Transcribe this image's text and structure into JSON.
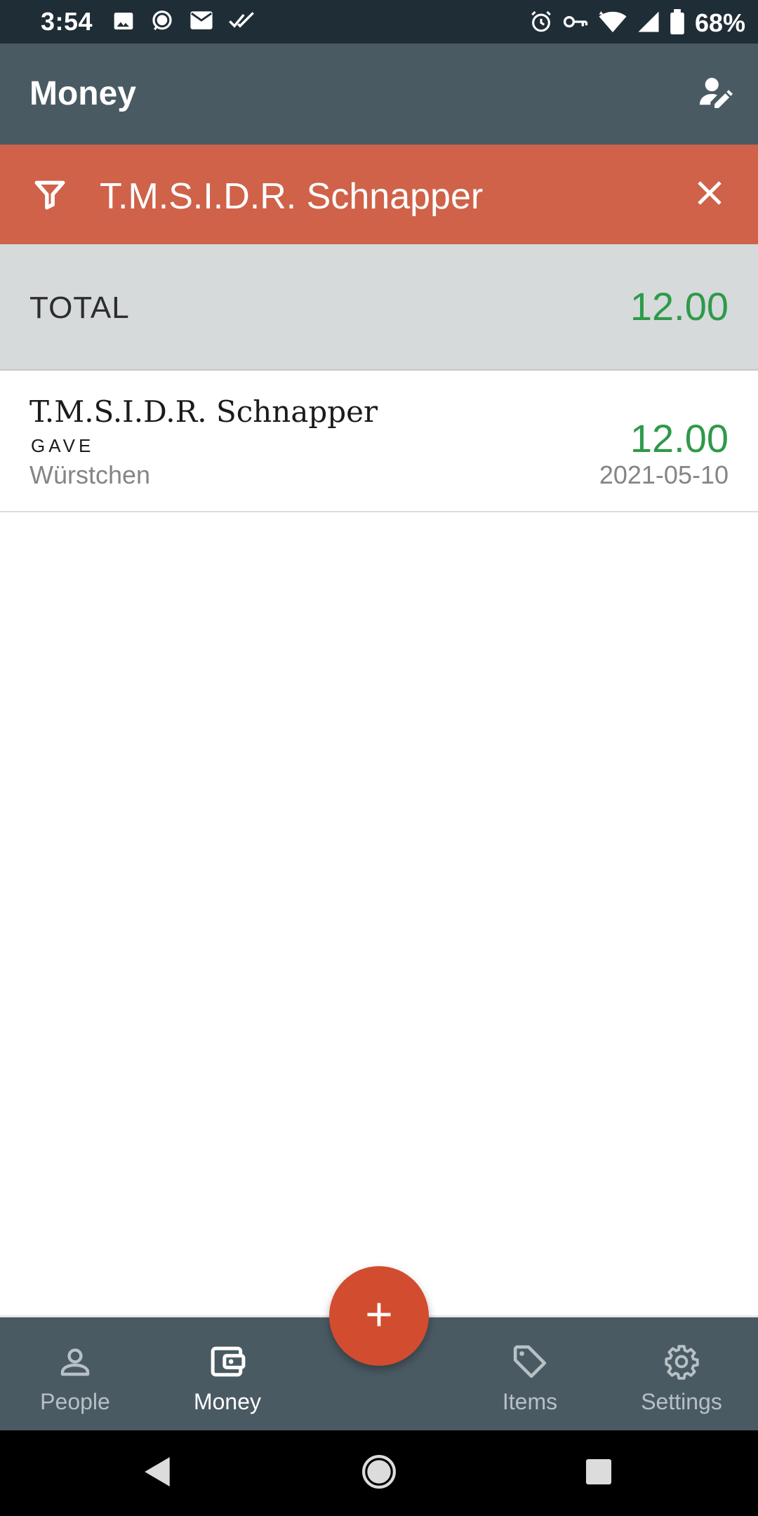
{
  "status_bar": {
    "time": "3:54",
    "battery": "68%",
    "left_icons": [
      "image-icon",
      "chat-bubble-icon",
      "mail-icon",
      "double-check-icon"
    ],
    "right_icons": [
      "alarm-icon",
      "key-icon",
      "wifi-icon",
      "signal-icon",
      "battery-icon"
    ]
  },
  "app_bar": {
    "title": "Money",
    "action_icon": "person-edit-icon"
  },
  "filter": {
    "text": "T.M.S.I.D.R. Schnapper",
    "icon": "filter-icon",
    "close_icon": "close-icon"
  },
  "total": {
    "label": "TOTAL",
    "value": "12.00"
  },
  "entries": [
    {
      "name": "T.M.S.I.D.R. Schnapper",
      "type": "GAVE",
      "note": "Würstchen",
      "amount": "12.00",
      "date": "2021-05-10"
    }
  ],
  "bottom_nav": {
    "items": [
      {
        "label": "People",
        "icon": "person-icon",
        "active": false
      },
      {
        "label": "Money",
        "icon": "wallet-icon",
        "active": true
      },
      {
        "label": "Items",
        "icon": "tag-icon",
        "active": false
      },
      {
        "label": "Settings",
        "icon": "gear-icon",
        "active": false
      }
    ]
  },
  "fab": {
    "icon": "plus-icon"
  },
  "colors": {
    "status_bar": "#1f2d36",
    "app_bar": "#4a5a63",
    "filter_bar": "#cf6249",
    "total_bg": "#d6dadb",
    "positive_amount": "#2e9a4a",
    "fab": "#d24c2f"
  }
}
